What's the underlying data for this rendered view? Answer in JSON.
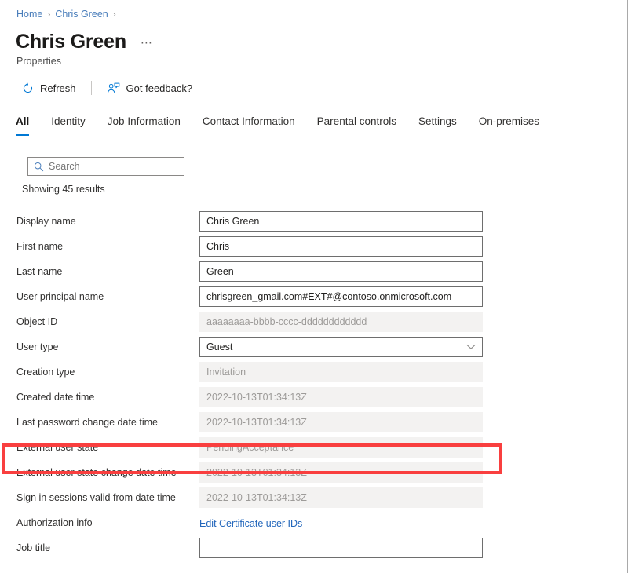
{
  "breadcrumb": {
    "items": [
      {
        "label": "Home"
      },
      {
        "label": "Chris Green"
      }
    ],
    "separator": "›"
  },
  "header": {
    "title": "Chris Green",
    "subtitle": "Properties",
    "more_label": "⋯"
  },
  "commandbar": {
    "refresh_label": "Refresh",
    "feedback_label": "Got feedback?"
  },
  "tabs": [
    {
      "label": "All",
      "active": true
    },
    {
      "label": "Identity",
      "active": false
    },
    {
      "label": "Job Information",
      "active": false
    },
    {
      "label": "Contact Information",
      "active": false
    },
    {
      "label": "Parental controls",
      "active": false
    },
    {
      "label": "Settings",
      "active": false
    },
    {
      "label": "On-premises",
      "active": false
    }
  ],
  "search": {
    "placeholder": "Search",
    "value": ""
  },
  "results": {
    "text": "Showing 45 results"
  },
  "fields": [
    {
      "label": "Display name",
      "value": "Chris Green",
      "type": "input"
    },
    {
      "label": "First name",
      "value": "Chris",
      "type": "input"
    },
    {
      "label": "Last name",
      "value": "Green",
      "type": "input"
    },
    {
      "label": "User principal name",
      "value": "chrisgreen_gmail.com#EXT#@contoso.onmicrosoft.com",
      "type": "input"
    },
    {
      "label": "Object ID",
      "value": "aaaaaaaa-bbbb-cccc-dddddddddddd",
      "type": "readonly"
    },
    {
      "label": "User type",
      "value": "Guest",
      "type": "select"
    },
    {
      "label": "Creation type",
      "value": "Invitation",
      "type": "readonly"
    },
    {
      "label": "Created date time",
      "value": "2022-10-13T01:34:13Z",
      "type": "readonly"
    },
    {
      "label": "Last password change date time",
      "value": "2022-10-13T01:34:13Z",
      "type": "readonly"
    },
    {
      "label": "External user state",
      "value": "PendingAcceptance",
      "type": "readonly"
    },
    {
      "label": "External user state change date time",
      "value": "2022-10-13T01:34:13Z",
      "type": "readonly"
    },
    {
      "label": "Sign in sessions valid from date time",
      "value": "2022-10-13T01:34:13Z",
      "type": "readonly"
    },
    {
      "label": "Authorization info",
      "value": "Edit Certificate user IDs",
      "type": "link"
    },
    {
      "label": "Job title",
      "value": "",
      "type": "input"
    }
  ],
  "highlight": {
    "target_label": "External user state",
    "color": "#f93f3f"
  },
  "colors": {
    "accent": "#0078d4",
    "link": "#2266bb",
    "breadcrumb_link": "#4a7ebb",
    "readonly_bg": "#f3f2f1",
    "highlight": "#f93f3f"
  },
  "icons": {
    "search": "search-icon",
    "refresh": "refresh-icon",
    "feedback": "feedback-person-icon",
    "dropdown": "chevron-down-icon"
  }
}
